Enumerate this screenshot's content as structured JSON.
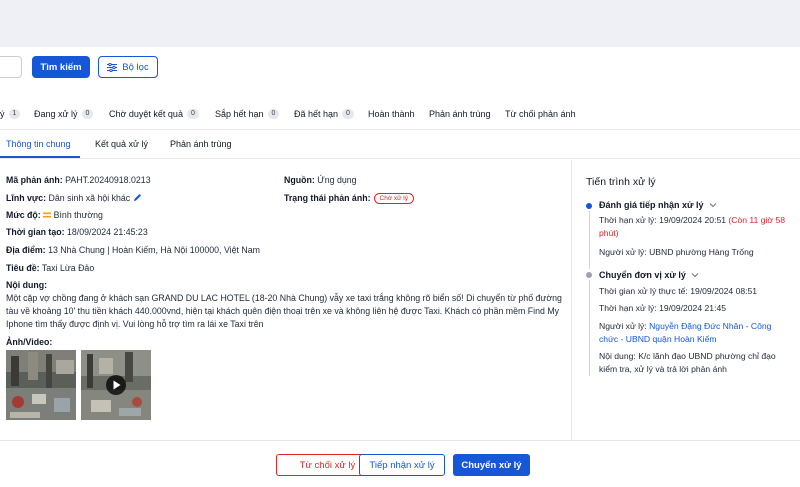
{
  "toolbar": {
    "search_label": "Tìm kiếm",
    "filter_label": "Bộ lọc"
  },
  "status_tabs": [
    {
      "label": "ý",
      "count": "1"
    },
    {
      "label": "Đang xử lý",
      "count": "0"
    },
    {
      "label": "Chờ duyệt kết quả",
      "count": "0"
    },
    {
      "label": "Sắp hết hạn",
      "count": "0"
    },
    {
      "label": "Đã hết hạn",
      "count": "0"
    },
    {
      "label": "Hoàn thành",
      "count": ""
    },
    {
      "label": "Phản ánh trùng",
      "count": ""
    },
    {
      "label": "Từ chối phản ánh",
      "count": ""
    }
  ],
  "sub_tabs": [
    "Thông tin chung",
    "Kết quả xử lý",
    "Phản ánh trùng"
  ],
  "details": {
    "code_label": "Mã phản ánh:",
    "code": "PAHT.20240918.0213",
    "source_label": "Nguồn:",
    "source": "Ứng dụng",
    "field_label": "Lĩnh vực:",
    "field": "Dân sinh xã hội khác",
    "state_label": "Trạng thái phản ánh:",
    "state": "Chờ xử lý",
    "level_label": "Mức độ:",
    "level": "Bình thường",
    "created_label": "Thời gian tạo:",
    "created": "18/09/2024 21:45:23",
    "location_label": "Địa điểm:",
    "location": "13 Nhà Chung | Hoàn Kiếm, Hà Nội 100000, Việt Nam",
    "title_label": "Tiêu đề:",
    "title": "Taxi Lừa Đảo",
    "content_label": "Nội dung:",
    "content": "Một cặp vợ chồng đang ở khách sạn GRAND DU LAC HOTEL (18-20 Nhà Chung) vẫy xe taxi trắng không rõ biển số! Di chuyển từ phố đường tàu về khoảng 10' thu tiền khách 440.000vnd, hiện tại khách quên điện thoại trên xe và không liên hệ được Taxi. Khách có phần mềm Find My Iphone tìm thấy được định vị. Vui lòng hỗ trợ tìm ra lái xe Taxi trên",
    "media_label": "Ảnh/Video:"
  },
  "timeline": {
    "title": "Tiến trình xử lý",
    "steps": [
      {
        "title": "Đánh giá tiếp nhận xử lý",
        "deadline_label": "Thời hạn xử lý:",
        "deadline": "19/09/2024 20:51",
        "remaining": "(Còn 11 giờ 58 phút)",
        "handler_label": "Người xử lý:",
        "handler": "UBND phường Hàng Trống"
      },
      {
        "title": "Chuyển đơn vị xử lý",
        "actual_label": "Thời gian xử lý thực tế:",
        "actual": "19/09/2024 08:51",
        "deadline_label": "Thời hạn xử lý:",
        "deadline": "19/09/2024 21:45",
        "handler_label": "Người xử lý:",
        "handler": "Nguyễn Đặng Đức Nhân - Công chức - UBND quận Hoàn Kiếm",
        "content_label": "Nội dung:",
        "content": "K/c lãnh đạo UBND phường chỉ đạo kiểm tra, xử lý và trả lời phản ánh"
      }
    ]
  },
  "footer": {
    "reject_label": "Từ chối xử lý",
    "accept_label": "Tiếp nhận xử lý",
    "transfer_label": "Chuyển xử lý"
  },
  "colors": {
    "primary": "#1557d6",
    "danger": "#dc2626",
    "level_accent": "#f59e0b"
  }
}
